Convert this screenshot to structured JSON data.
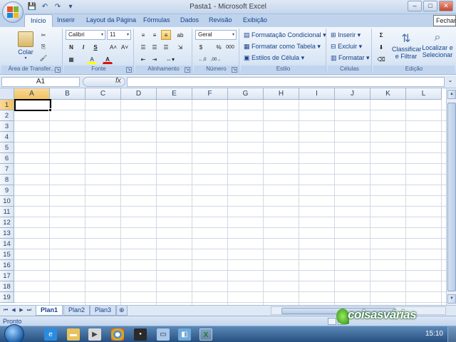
{
  "window": {
    "title": "Pasta1 - Microsoft Excel",
    "minimize": "–",
    "maximize": "□",
    "close": "✕",
    "tooltip": "Fechar"
  },
  "qat": {
    "save": "💾",
    "undo": "↶",
    "redo": "↷",
    "more": "▾"
  },
  "tabs": [
    "Início",
    "Inserir",
    "Layout da Página",
    "Fórmulas",
    "Dados",
    "Revisão",
    "Exibição"
  ],
  "ribbon": {
    "clipboard": {
      "label": "Área de Transfer...",
      "paste": "Colar",
      "cut": "✂",
      "copy": "⎘",
      "format_painter": "🖌"
    },
    "font": {
      "label": "Fonte",
      "name": "Calibri",
      "size": "11",
      "bold": "N",
      "italic": "I",
      "underline": "S",
      "grow": "A˄",
      "shrink": "A˅",
      "borders": "▦",
      "fill": "A",
      "color": "A"
    },
    "alignment": {
      "label": "Alinhamento"
    },
    "number": {
      "label": "Número",
      "format": "Geral",
      "currency": "$",
      "percent": "%",
      "thousands": "000",
      "inc_dec": "←,0",
      "dec_dec": ",00→"
    },
    "styles": {
      "label": "Estilo",
      "conditional": "Formatação Condicional",
      "table": "Formatar como Tabela",
      "cell_styles": "Estilos de Célula"
    },
    "cells": {
      "label": "Células",
      "insert": "Inserir",
      "delete": "Excluir",
      "format": "Formatar"
    },
    "editing": {
      "label": "Edição",
      "sum": "Σ",
      "sort_line1": "Classificar",
      "sort_line2": "e Filtrar",
      "find_line1": "Localizar e",
      "find_line2": "Selecionar"
    }
  },
  "formula_bar": {
    "name_box": "A1",
    "fx": "fx",
    "value": ""
  },
  "columns": [
    "A",
    "B",
    "C",
    "D",
    "E",
    "F",
    "G",
    "H",
    "I",
    "J",
    "K",
    "L"
  ],
  "rows": [
    "1",
    "2",
    "3",
    "4",
    "5",
    "6",
    "7",
    "8",
    "9",
    "10",
    "11",
    "12",
    "13",
    "14",
    "15",
    "16",
    "17",
    "18",
    "19"
  ],
  "sheets": [
    "Plan1",
    "Plan2",
    "Plan3"
  ],
  "status": {
    "text": "Pronto"
  },
  "watermark": "coisasvárias",
  "taskbar": {
    "clock": "15:10"
  },
  "colors": {
    "ribbon_bg": "#dbe7f5",
    "selected_header": "#f1c15f",
    "grid_line": "#d0d7e5"
  }
}
